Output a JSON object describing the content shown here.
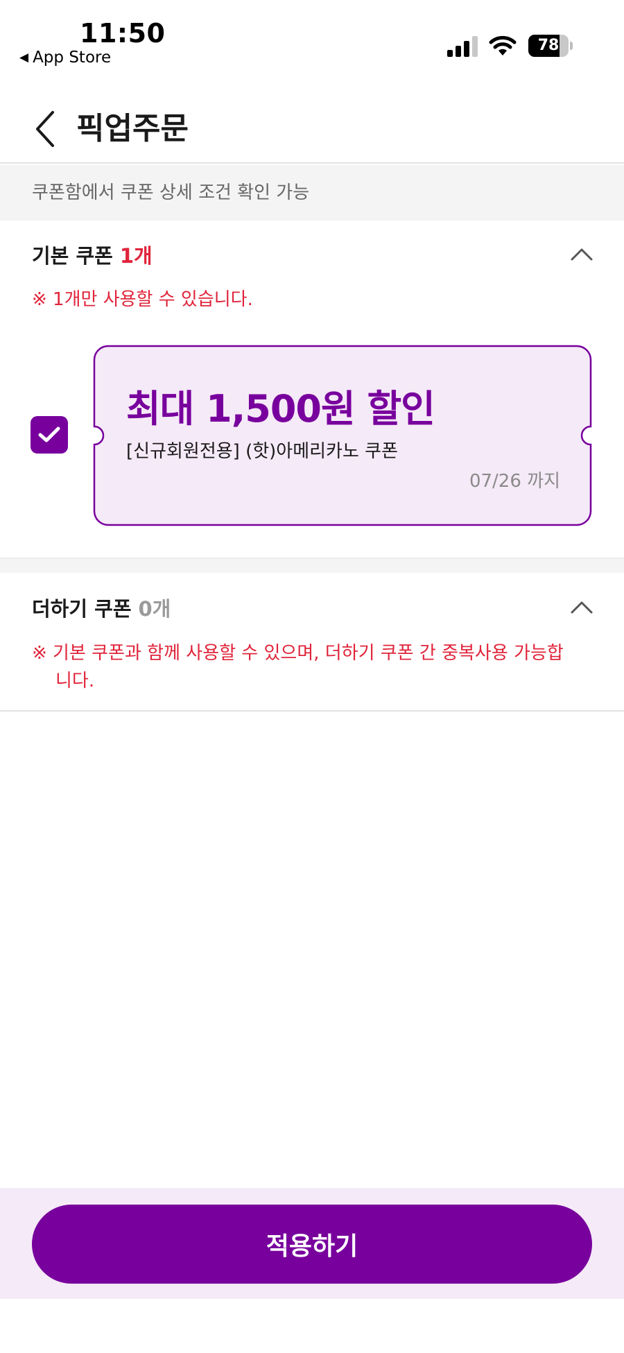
{
  "status_bar": {
    "time": "11:50",
    "back_app_label": "App Store",
    "battery": "78",
    "battery_level": 0.78
  },
  "header": {
    "title": "픽업주문"
  },
  "info_banner": {
    "text": "쿠폰함에서 쿠폰 상세 조건 확인 가능"
  },
  "basic_coupon": {
    "title": "기본 쿠폰",
    "count": "1개",
    "notice": "※ 1개만 사용할 수 있습니다.",
    "coupons": [
      {
        "checked": true,
        "amount": "최대 1,500원 할인",
        "name": "[신규회원전용] (핫)아메리카노 쿠폰",
        "expiry": "07/26 까지"
      }
    ]
  },
  "plus_coupon": {
    "title": "더하기 쿠폰",
    "count": "0개",
    "notice_line1": "※ 기본 쿠폰과 함께 사용할 수 있으며, 더하기 쿠폰 간 중복사용 가능합",
    "notice_line2": "니다."
  },
  "footer": {
    "apply_label": "적용하기"
  },
  "colors": {
    "accent": "#78009d",
    "coupon_bg": "#f5eaf7",
    "alert_red": "#e0243b"
  }
}
